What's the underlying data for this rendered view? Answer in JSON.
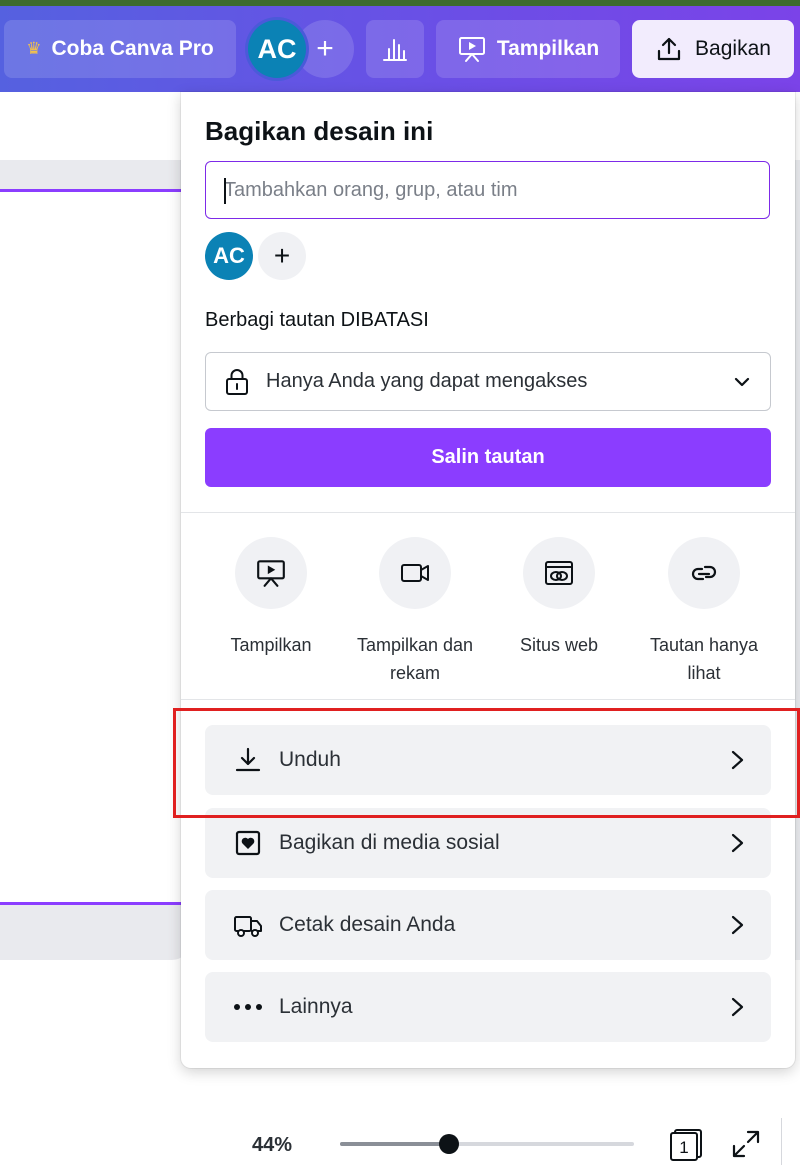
{
  "topbar": {
    "pro_label": "Coba Canva Pro",
    "avatar_initials": "AC",
    "present_label": "Tampilkan",
    "share_label": "Bagikan"
  },
  "share_panel": {
    "title": "Bagikan desain ini",
    "people_input": {
      "placeholder": "Tambahkan orang, grup, atau tim",
      "value": ""
    },
    "collaborator_initials": "AC",
    "link_section_label": "Berbagi tautan DIBATASI",
    "access_select": {
      "value": "Hanya Anda yang dapat mengakses"
    },
    "copy_link_label": "Salin tautan",
    "options": [
      {
        "label": "Tampilkan",
        "icon": "present-icon"
      },
      {
        "label": "Tampilkan dan rekam",
        "icon": "video-camera-icon"
      },
      {
        "label": "Situs web",
        "icon": "website-icon"
      },
      {
        "label": "Tautan hanya lihat",
        "icon": "link-icon"
      }
    ],
    "rows": [
      {
        "label": "Unduh",
        "icon": "download-icon"
      },
      {
        "label": "Bagikan di media sosial",
        "icon": "heart-frame-icon"
      },
      {
        "label": "Cetak desain Anda",
        "icon": "truck-icon"
      },
      {
        "label": "Lainnya",
        "icon": "more-icon"
      }
    ],
    "highlight_color": "#e02020",
    "accent_color": "#8b3dff"
  },
  "zoom": {
    "label": "44%",
    "level": 0.37,
    "page_number": "1"
  }
}
